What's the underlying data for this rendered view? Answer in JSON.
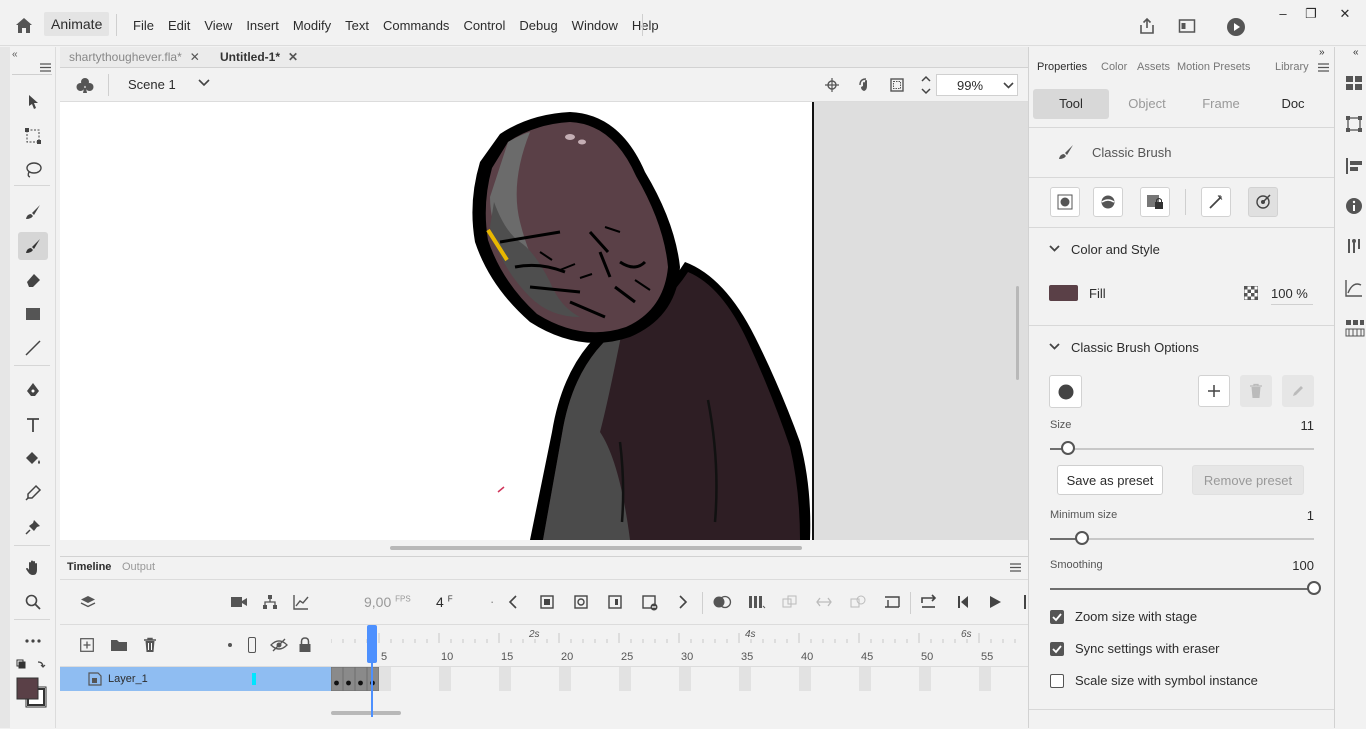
{
  "app": {
    "name": "Animate"
  },
  "menu": [
    "File",
    "Edit",
    "View",
    "Insert",
    "Modify",
    "Text",
    "Commands",
    "Control",
    "Debug",
    "Window",
    "Help"
  ],
  "window_controls": {
    "minimize": "–",
    "restore": "❐",
    "close": "✕"
  },
  "doc_tabs": [
    {
      "label": "shartythoughever.fla*",
      "active": false
    },
    {
      "label": "Untitled-1*",
      "active": true
    }
  ],
  "scene": {
    "label": "Scene 1",
    "zoom": "99%"
  },
  "timeline": {
    "tabs": [
      "Timeline",
      "Output"
    ],
    "fps": "9,00",
    "fps_unit": "FPS",
    "frame": "4",
    "frame_unit": "F",
    "frame_numbers": [
      "5",
      "10",
      "15",
      "20",
      "25",
      "30",
      "35",
      "40",
      "45",
      "50",
      "55"
    ],
    "seconds": [
      "2s",
      "4s",
      "6s"
    ],
    "layer_name": "Layer_1",
    "current_frame": 5
  },
  "properties": {
    "tabs": [
      "Properties",
      "Color",
      "Assets",
      "Motion Presets",
      "Library"
    ],
    "segments": [
      "Tool",
      "Object",
      "Frame",
      "Doc"
    ],
    "tool_name": "Classic Brush",
    "color_style": {
      "header": "Color and Style",
      "fill_label": "Fill",
      "fill_color": "#5a4047",
      "fill_alpha": "100 %"
    },
    "brush_options": {
      "header": "Classic Brush Options",
      "size_label": "Size",
      "size_value": "11",
      "size_fraction": 0.07,
      "save_preset": "Save as preset",
      "remove_preset": "Remove preset",
      "min_size_label": "Minimum size",
      "min_size_value": "1",
      "min_size_fraction": 0.12,
      "smoothing_label": "Smoothing",
      "smoothing_value": "100",
      "smoothing_fraction": 1.0
    },
    "checkboxes": [
      {
        "label": "Zoom size with stage",
        "checked": true
      },
      {
        "label": "Sync settings with eraser",
        "checked": true
      },
      {
        "label": "Scale size with symbol instance",
        "checked": false
      }
    ]
  },
  "colors": {
    "accent": "#4d90fe",
    "playhead": "#4d90fe",
    "layer_selected": "#8fbdf2",
    "stroke_color": "#5a4047"
  }
}
